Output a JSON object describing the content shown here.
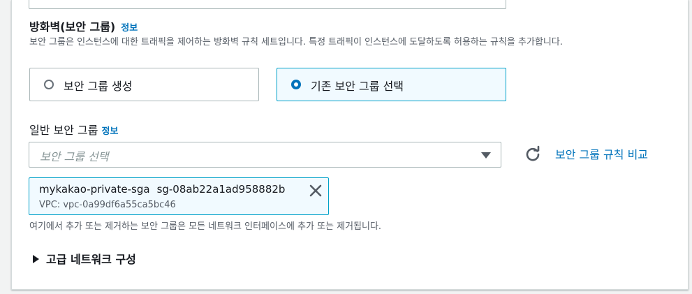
{
  "firewall": {
    "title": "방화벽(보안 그룹)",
    "info": "정보",
    "description": "보안 그룹은 인스턴스에 대한 트래픽을 제어하는 방화벽 규칙 세트입니다. 특정 트래픽이 인스턴스에 도달하도록 허용하는 규칙을 추가합니다.",
    "options": [
      {
        "label": "보안 그룹 생성",
        "selected": false
      },
      {
        "label": "기존 보안 그룹 선택",
        "selected": true
      }
    ]
  },
  "common_sg": {
    "label": "일반 보안 그룹",
    "info": "정보",
    "placeholder": "보안 그룹 선택",
    "compare_link": "보안 그룹 규칙 비교",
    "selected_token": {
      "name": "mykakao-private-sga",
      "id": "sg-08ab22a1ad958882b",
      "vpc": "VPC: vpc-0a99df6a55ca5bc46"
    },
    "constraint": "여기에서 추가 또는 제거하는 보안 그룹은 모든 네트워크 인터페이스에 추가 또는 제거됩니다."
  },
  "advanced": {
    "label": "고급 네트워크 구성"
  },
  "colors": {
    "link": "#0073bb",
    "selected_border": "#00a1c9",
    "selected_bg": "#f1faff"
  },
  "icons": {
    "refresh": "refresh-icon",
    "close": "close-icon",
    "dropdown": "caret-down-icon",
    "expand": "caret-right-icon"
  }
}
